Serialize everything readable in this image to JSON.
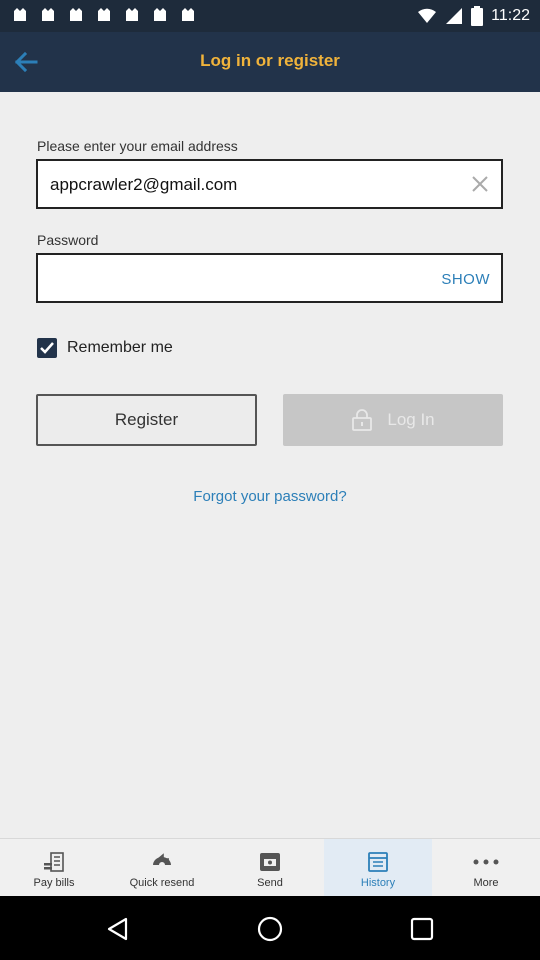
{
  "status_bar": {
    "time": "11:22",
    "left_icons": [
      "app-notification-icon",
      "app-notification-icon",
      "app-notification-icon",
      "app-notification-icon",
      "app-notification-icon",
      "app-notification-icon",
      "app-notification-icon"
    ]
  },
  "header": {
    "title": "Log in or register",
    "title_color": "#f0b33b"
  },
  "form": {
    "email_label": "Please enter your email address",
    "email_value": "appcrawler2@gmail.com",
    "password_label": "Password",
    "password_value": "",
    "show_label": "SHOW",
    "remember_label": "Remember me",
    "remember_checked": true,
    "register_label": "Register",
    "login_label": "Log In",
    "forgot_label": "Forgot your password?"
  },
  "tabs": [
    {
      "label": "Pay bills",
      "icon": "bills-icon"
    },
    {
      "label": "Quick resend",
      "icon": "quick-resend-icon"
    },
    {
      "label": "Send",
      "icon": "send-money-icon"
    },
    {
      "label": "History",
      "icon": "history-icon",
      "active": true
    },
    {
      "label": "More",
      "icon": "more-dots-icon"
    }
  ],
  "colors": {
    "app_bar": "#22334a",
    "link": "#2c7fb8",
    "accent": "#f0b33b"
  }
}
